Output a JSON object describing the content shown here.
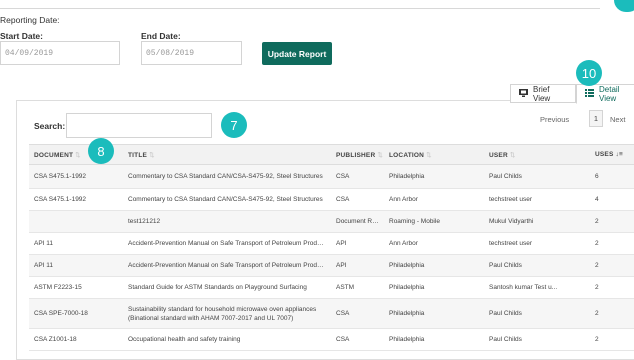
{
  "filters": {
    "reporting_date_label": "Reporting Date:",
    "start_label": "Start Date:",
    "start_value": "04/09/2019",
    "end_label": "End Date:",
    "end_value": "05/08/2019",
    "update_button": "Update Report"
  },
  "view_tabs": {
    "brief": "Brief View",
    "detail": "Detail View"
  },
  "badges": {
    "b7": "7",
    "b8": "8",
    "b10": "10"
  },
  "search": {
    "label": "Search:",
    "value": ""
  },
  "pager": {
    "previous": "Previous",
    "page": "1",
    "next": "Next"
  },
  "table": {
    "columns": [
      "DOCUMENT",
      "TITLE",
      "PUBLISHER",
      "LOCATION",
      "USER",
      "USES"
    ],
    "rows": [
      [
        "CSA S475.1-1992",
        "Commentary to CSA Standard CAN/CSA-S475-92, Steel Structures",
        "CSA",
        "Philadelphia",
        "Paul Childs",
        "6"
      ],
      [
        "CSA S475.1-1992",
        "Commentary to CSA Standard CAN/CSA-S475-92, Steel Structures",
        "CSA",
        "Ann Arbor",
        "techstreet user",
        "4"
      ],
      [
        "",
        "test121212",
        "Document Repo...",
        "Roaming - Mobile",
        "Mukul Vidyarthi",
        "2"
      ],
      [
        "API 11",
        "Accident-Prevention Manual on Safe Transport of Petroleum Produc...",
        "API",
        "Ann Arbor",
        "techstreet user",
        "2"
      ],
      [
        "API 11",
        "Accident-Prevention Manual on Safe Transport of Petroleum Produc...",
        "API",
        "Philadelphia",
        "Paul Childs",
        "2"
      ],
      [
        "ASTM F2223-15",
        "Standard Guide for ASTM Standards on Playground Surfacing",
        "ASTM",
        "Philadelphia",
        "Santosh kumar Test u...",
        "2"
      ],
      [
        "CSA SPE-7000-18",
        "Sustainability standard for household microwave oven appliances (Binational standard with AHAM 7007-2017 and UL 7007)",
        "CSA",
        "Philadelphia",
        "Paul Childs",
        "2"
      ],
      [
        "CSA Z1001-18",
        "Occupational health and safety training",
        "CSA",
        "Philadelphia",
        "Paul Childs",
        "2"
      ]
    ]
  },
  "colors": {
    "accent": "#1bbcbc",
    "button": "#0f6b5d"
  }
}
